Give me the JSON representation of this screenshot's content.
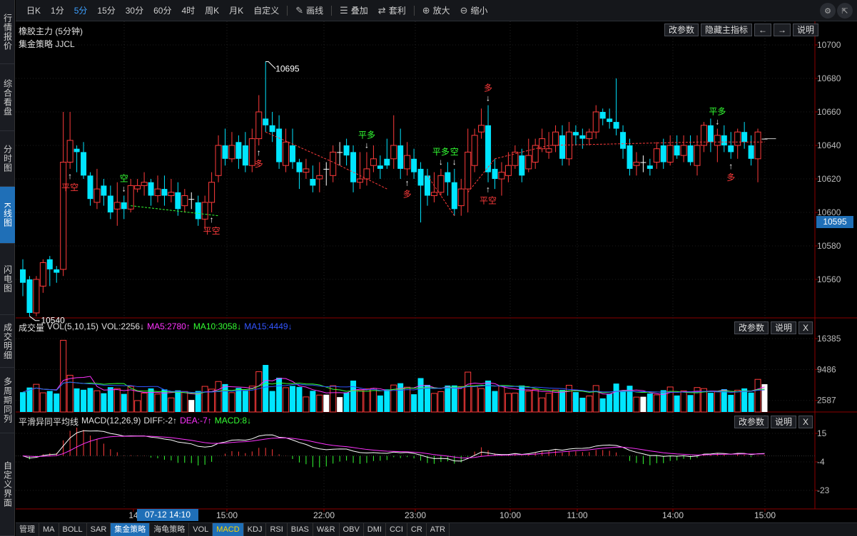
{
  "toolbar": {
    "periods": [
      "日K",
      "1分",
      "5分",
      "15分",
      "30分",
      "60分",
      "4时",
      "周K",
      "月K",
      "自定义"
    ],
    "active_period": "5分",
    "tools": [
      {
        "icon": "pencil-icon",
        "label": "画线"
      },
      {
        "icon": "layers-icon",
        "label": "叠加"
      },
      {
        "icon": "arbitrage-icon",
        "label": "套利"
      },
      {
        "icon": "zoom-in-icon",
        "label": "放大"
      },
      {
        "icon": "zoom-out-icon",
        "label": "缩小"
      }
    ]
  },
  "left_rail": [
    "行情报价",
    "综合看盘",
    "分时图",
    "K线图",
    "闪电图",
    "成交明细",
    "多周期同列",
    "自定义界面"
  ],
  "left_rail_active": "K线图",
  "main_panel": {
    "title": "橡胶主力 (5分钟)",
    "strategy": "集金策略 JJCL",
    "buttons": [
      "改参数",
      "隐藏主指标",
      "←",
      "→",
      "说明"
    ],
    "current_price": "10595",
    "high_label": "10695",
    "low_label": "10540"
  },
  "volume_panel": {
    "name": "成交量",
    "params": "VOL(5,10,15)",
    "vol": "VOL:2256↓",
    "ma5": "MA5:2780↑",
    "ma10": "MA10:3058↓",
    "ma15": "MA15:4449↓",
    "buttons": [
      "改参数",
      "说明",
      "X"
    ],
    "axis": [
      "16385",
      "9486",
      "2587"
    ]
  },
  "macd_panel": {
    "name": "平滑异同平均线",
    "params": "MACD(12,26,9)",
    "diff": "DIFF:-2↑",
    "dea": "DEA:-7↑",
    "macd": "MACD:8↓",
    "buttons": [
      "改参数",
      "说明",
      "X"
    ],
    "axis": [
      "15",
      "-4",
      "-23"
    ]
  },
  "time_axis": {
    "labels": [
      "14",
      "15:00",
      "22:00",
      "23:00",
      "10:00",
      "11:00",
      "14:00",
      "15:00"
    ],
    "cursor": "07-12 14:10"
  },
  "price_axis": [
    "10700",
    "10680",
    "10660",
    "10640",
    "10620",
    "10600",
    "10580",
    "10560"
  ],
  "signals": [
    {
      "text": "平空",
      "color": "red"
    },
    {
      "text": "空",
      "color": "green"
    },
    {
      "text": "平空",
      "color": "red"
    },
    {
      "text": "多",
      "color": "red"
    },
    {
      "text": "平多",
      "color": "green"
    },
    {
      "text": "多",
      "color": "red"
    },
    {
      "text": "平多",
      "color": "green"
    },
    {
      "text": "空",
      "color": "green"
    },
    {
      "text": "多",
      "color": "red"
    },
    {
      "text": "平空",
      "color": "red"
    },
    {
      "text": "平多",
      "color": "green"
    },
    {
      "text": "多",
      "color": "red"
    }
  ],
  "bottom_tabs": [
    "管理",
    "MA",
    "BOLL",
    "SAR",
    "集金策略",
    "海龟策略",
    "VOL",
    "MACD",
    "KDJ",
    "RSI",
    "BIAS",
    "W&R",
    "OBV",
    "DMI",
    "CCI",
    "CR",
    "ATR"
  ],
  "bottom_active_blue": "集金策略",
  "bottom_active_yellow": "MACD",
  "colors": {
    "up": "#ff3b3b",
    "down": "#00e5ff",
    "accent": "#1f6fb7",
    "ma5": "#ff33ff",
    "ma10": "#33ff33",
    "ma15": "#3355ff",
    "dea": "#ff33ff"
  },
  "chart_data": {
    "type": "candlestick",
    "symbol": "橡胶主力",
    "interval": "5分钟",
    "candles": [
      [
        10566,
        10558,
        10572,
        10550
      ],
      [
        10560,
        10540,
        10562,
        10538
      ],
      [
        10540,
        10560,
        10562,
        10538
      ],
      [
        10556,
        10570,
        10572,
        10552
      ],
      [
        10572,
        10566,
        10574,
        10556
      ],
      [
        10566,
        10564,
        10568,
        10558
      ],
      [
        10566,
        10630,
        10660,
        10562
      ],
      [
        10630,
        10643,
        10660,
        10626
      ],
      [
        10638,
        10636,
        10640,
        10624
      ],
      [
        10636,
        10622,
        10642,
        10620
      ],
      [
        10622,
        10608,
        10624,
        10604
      ],
      [
        10606,
        10614,
        10626,
        10602
      ],
      [
        10616,
        10610,
        10620,
        10604
      ],
      [
        10610,
        10600,
        10616,
        10596
      ],
      [
        10602,
        10606,
        10618,
        10592
      ],
      [
        10606,
        10602,
        10610,
        10596
      ],
      [
        10602,
        10616,
        10620,
        10600
      ],
      [
        10614,
        10616,
        10620,
        10612
      ],
      [
        10616,
        10618,
        10624,
        10610
      ],
      [
        10618,
        10610,
        10620,
        10604
      ],
      [
        10610,
        10614,
        10622,
        10606
      ],
      [
        10614,
        10610,
        10622,
        10604
      ],
      [
        10610,
        10612,
        10620,
        10606
      ],
      [
        10612,
        10602,
        10618,
        10598
      ],
      [
        10604,
        10610,
        10614,
        10600
      ],
      [
        10608,
        10608,
        10612,
        10602
      ],
      [
        10606,
        10596,
        10610,
        10592
      ],
      [
        10596,
        10606,
        10610,
        10590
      ],
      [
        10606,
        10618,
        10624,
        10600
      ],
      [
        10622,
        10640,
        10646,
        10618
      ],
      [
        10640,
        10632,
        10650,
        10628
      ],
      [
        10632,
        10640,
        10648,
        10630
      ],
      [
        10642,
        10632,
        10646,
        10626
      ],
      [
        10640,
        10628,
        10648,
        10624
      ],
      [
        10628,
        10644,
        10650,
        10624
      ],
      [
        10644,
        10660,
        10670,
        10640
      ],
      [
        10656,
        10652,
        10690,
        10648
      ],
      [
        10652,
        10648,
        10660,
        10642
      ],
      [
        10650,
        10630,
        10658,
        10626
      ],
      [
        10628,
        10642,
        10650,
        10624
      ],
      [
        10640,
        10630,
        10650,
        10626
      ],
      [
        10630,
        10624,
        10632,
        10614
      ],
      [
        10624,
        10626,
        10632,
        10620
      ],
      [
        10620,
        10616,
        10628,
        10612
      ],
      [
        10620,
        10622,
        10630,
        10612
      ],
      [
        10626,
        10626,
        10630,
        10616
      ],
      [
        10622,
        10636,
        10640,
        10618
      ],
      [
        10636,
        10636,
        10642,
        10628
      ],
      [
        10640,
        10634,
        10644,
        10628
      ],
      [
        10636,
        10618,
        10640,
        10612
      ],
      [
        10618,
        10620,
        10636,
        10614
      ],
      [
        10620,
        10626,
        10636,
        10616
      ],
      [
        10628,
        10632,
        10640,
        10624
      ],
      [
        10628,
        10626,
        10634,
        10620
      ],
      [
        10632,
        10628,
        10644,
        10626
      ],
      [
        10632,
        10640,
        10658,
        10626
      ],
      [
        10640,
        10626,
        10650,
        10620
      ],
      [
        10626,
        10634,
        10642,
        10622
      ],
      [
        10632,
        10624,
        10638,
        10620
      ],
      [
        10626,
        10616,
        10630,
        10594
      ],
      [
        10622,
        10610,
        10626,
        10604
      ],
      [
        10610,
        10612,
        10624,
        10606
      ],
      [
        10612,
        10622,
        10626,
        10610
      ],
      [
        10624,
        10618,
        10630,
        10610
      ],
      [
        10618,
        10602,
        10626,
        10598
      ],
      [
        10604,
        10614,
        10620,
        10598
      ],
      [
        10614,
        10636,
        10650,
        10600
      ],
      [
        10628,
        10646,
        10650,
        10624
      ],
      [
        10648,
        10652,
        10662,
        10644
      ],
      [
        10652,
        10624,
        10664,
        10618
      ],
      [
        10626,
        10620,
        10632,
        10614
      ],
      [
        10620,
        10624,
        10630,
        10610
      ],
      [
        10622,
        10628,
        10636,
        10618
      ],
      [
        10628,
        10636,
        10640,
        10626
      ],
      [
        10634,
        10622,
        10638,
        10618
      ],
      [
        10626,
        10634,
        10644,
        10624
      ],
      [
        10630,
        10640,
        10644,
        10626
      ],
      [
        10638,
        10644,
        10650,
        10636
      ],
      [
        10636,
        10638,
        10648,
        10632
      ],
      [
        10640,
        10648,
        10652,
        10636
      ],
      [
        10646,
        10632,
        10652,
        10628
      ],
      [
        10632,
        10648,
        10654,
        10628
      ],
      [
        10648,
        10646,
        10652,
        10640
      ],
      [
        10646,
        10644,
        10650,
        10638
      ],
      [
        10644,
        10648,
        10650,
        10640
      ],
      [
        10648,
        10660,
        10664,
        10644
      ],
      [
        10660,
        10656,
        10662,
        10652
      ],
      [
        10656,
        10654,
        10662,
        10650
      ],
      [
        10654,
        10650,
        10680,
        10646
      ],
      [
        10648,
        10638,
        10652,
        10632
      ],
      [
        10640,
        10626,
        10644,
        10622
      ],
      [
        10628,
        10630,
        10636,
        10622
      ],
      [
        10630,
        10630,
        10634,
        10624
      ],
      [
        10628,
        10626,
        10632,
        10622
      ],
      [
        10630,
        10638,
        10642,
        10626
      ],
      [
        10640,
        10630,
        10644,
        10626
      ],
      [
        10630,
        10640,
        10646,
        10628
      ],
      [
        10640,
        10634,
        10646,
        10632
      ],
      [
        10634,
        10640,
        10646,
        10630
      ],
      [
        10640,
        10630,
        10646,
        10628
      ],
      [
        10628,
        10640,
        10646,
        10622
      ],
      [
        10640,
        10652,
        10654,
        10636
      ],
      [
        10652,
        10642,
        10656,
        10636
      ],
      [
        10640,
        10646,
        10650,
        10630
      ],
      [
        10646,
        10640,
        10652,
        10636
      ],
      [
        10640,
        10636,
        10648,
        10632
      ],
      [
        10640,
        10648,
        10650,
        10632
      ],
      [
        10648,
        10642,
        10654,
        10638
      ],
      [
        10640,
        10632,
        10646,
        10628
      ],
      [
        10632,
        10648,
        10650,
        10618
      ],
      [
        10644,
        10644,
        10644,
        10644
      ]
    ],
    "volume_ma": {
      "ma5": 2780,
      "ma10": 3058,
      "ma15": 4449
    },
    "macd_last": {
      "diff": -2,
      "dea": -7,
      "macd": 8
    }
  }
}
